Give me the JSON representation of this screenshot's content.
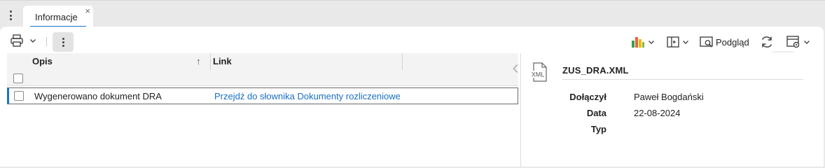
{
  "tabs": [
    {
      "label": "Informacje",
      "close": "×"
    }
  ],
  "toolbar": {
    "preview_label": "Podgląd"
  },
  "grid": {
    "columns": [
      "Opis",
      "Link"
    ],
    "sort_indicator": "↑",
    "rows": [
      {
        "opis": "Wygenerowano dokument DRA",
        "link": "Przejdź do słownika Dokumenty rozliczeniowe"
      }
    ]
  },
  "details": {
    "file_name": "ZUS_DRA.XML",
    "file_icon_label": "XML",
    "fields": [
      {
        "label": "Dołączył",
        "value": "Paweł Bogdański"
      },
      {
        "label": "Data",
        "value": "22-08-2024"
      },
      {
        "label": "Typ",
        "value": ""
      }
    ]
  },
  "icons": [
    "more-vertical-icon",
    "print-icon",
    "chevron-down-icon",
    "chart-icon",
    "layout-icon",
    "preview-icon",
    "refresh-icon",
    "settings-icon",
    "collapse-left-icon",
    "xml-file-icon",
    "sort-asc-icon",
    "close-icon"
  ],
  "colors": {
    "accent": "#1a73c9",
    "link": "#1a6fc1",
    "background": "#e9e9ea"
  }
}
